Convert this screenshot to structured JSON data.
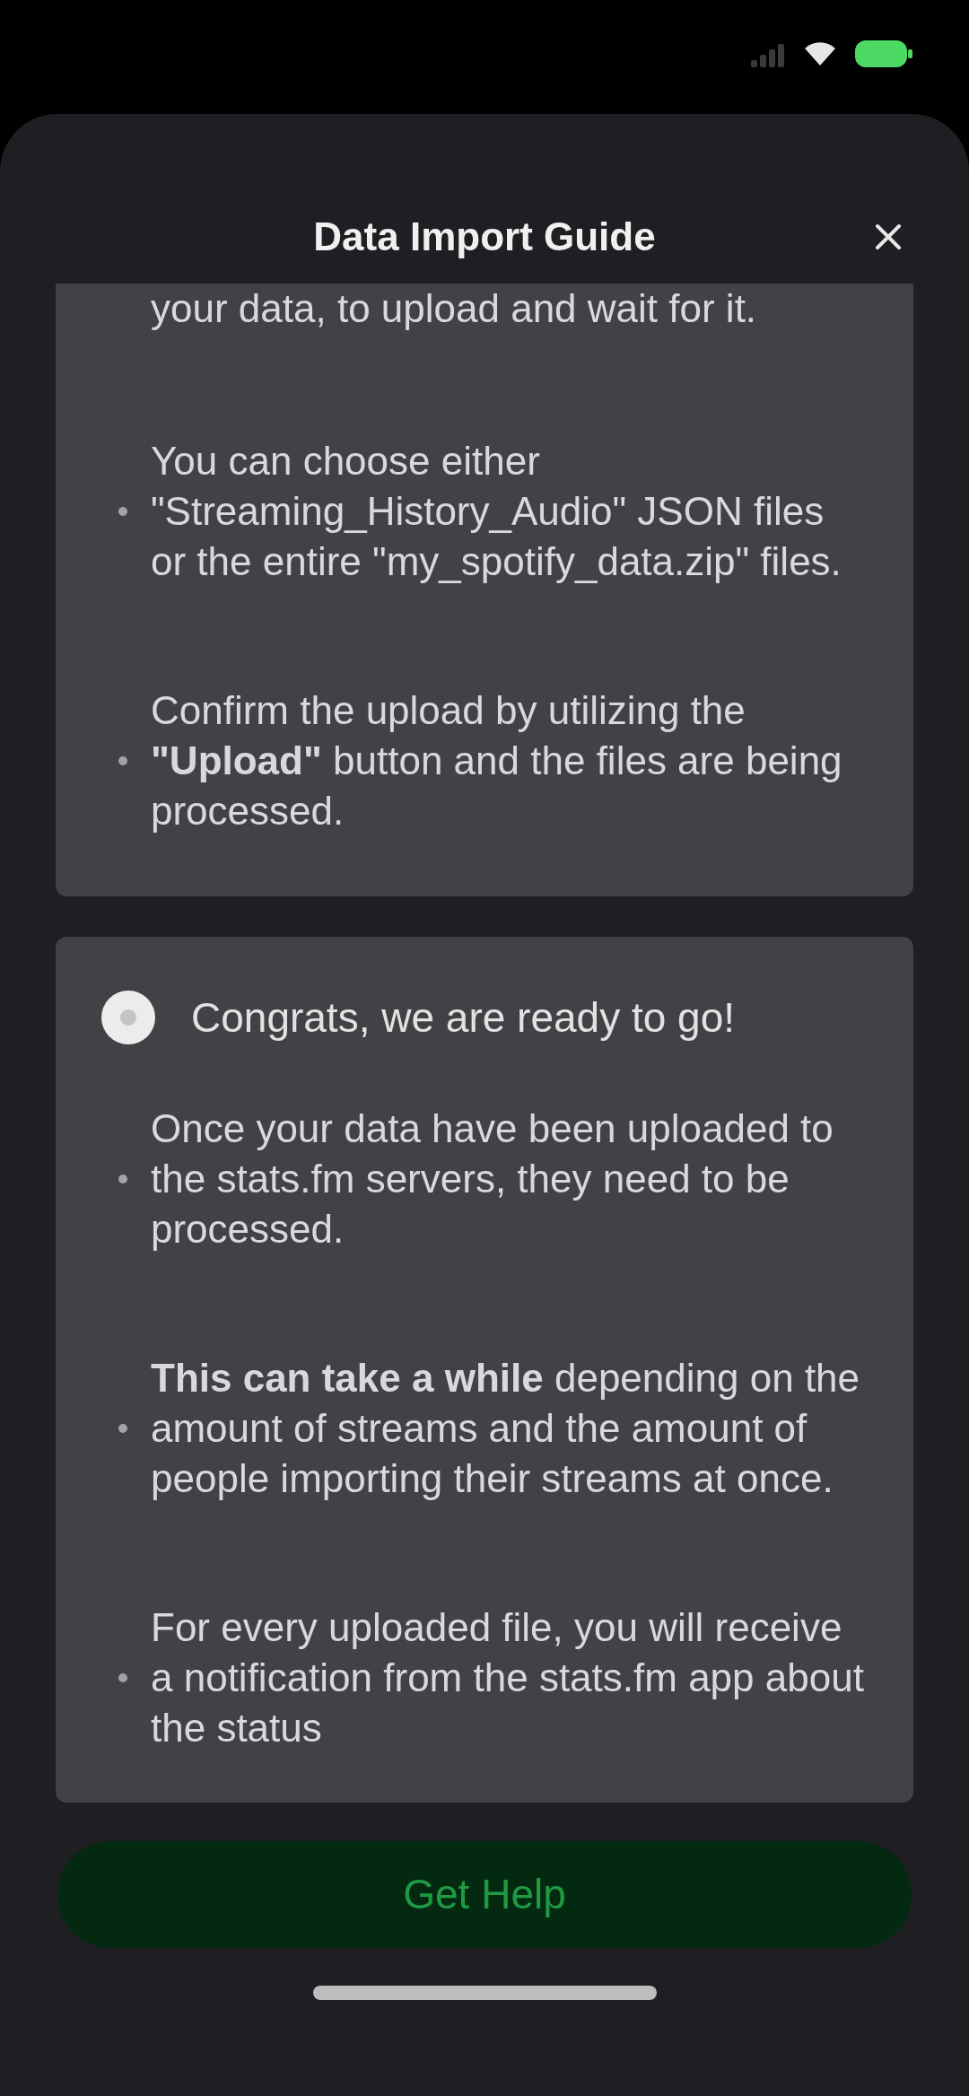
{
  "header": {
    "title": "Data Import Guide"
  },
  "sections": [
    {
      "clipped_text": "your data, to upload and wait for it.",
      "items": [
        "You can choose either \"Streaming_History_Audio\" JSON files or the entire \"my_spotify_data.zip\" files.",
        "Confirm the upload by utilizing the **\"Upload\"** button and the files are being processed."
      ]
    },
    {
      "title": "Congrats, we are ready to go!",
      "items": [
        "Once your data have been uploaded to the stats.fm servers, they need to be processed.",
        "**This can take a while** depending on the amount of streams and the amount of people importing their streams at once.",
        "For every uploaded file, you will receive a notification from the stats.fm app about the status"
      ]
    }
  ],
  "button": {
    "label": "Get Help"
  }
}
